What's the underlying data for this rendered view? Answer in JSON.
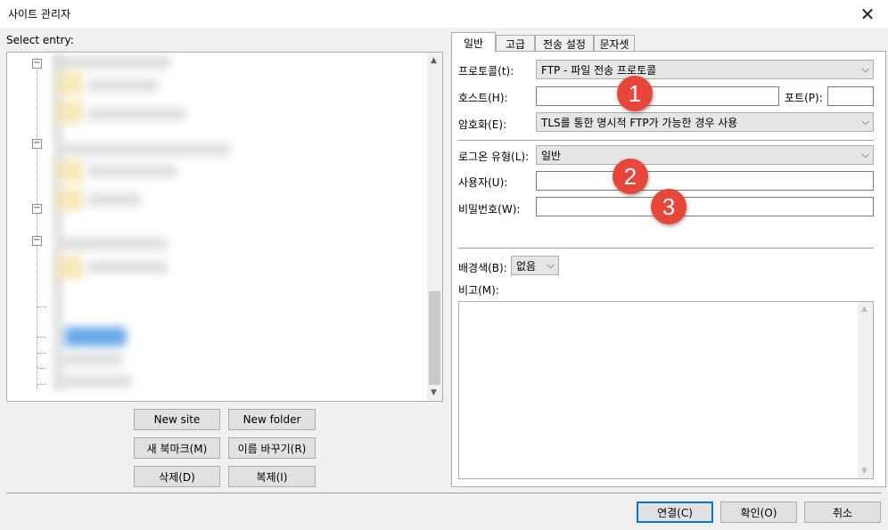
{
  "window": {
    "title": "사이트 관리자",
    "close_icon": "close-icon"
  },
  "left": {
    "select_entry_label": "Select entry:",
    "buttons": {
      "new_site": "New site",
      "new_folder": "New folder",
      "new_bookmark": "새 북마크(M)",
      "rename": "이름 바꾸기(R)",
      "delete": "삭제(D)",
      "duplicate": "복제(I)"
    }
  },
  "tabs": [
    "일반",
    "고급",
    "전송 설정",
    "문자셋"
  ],
  "general": {
    "protocol_label": "프로토콜(t):",
    "protocol_value": "FTP - 파일 전송 프로토콜",
    "host_label": "호스트(H):",
    "host_value": "",
    "port_label": "포트(P):",
    "port_value": "",
    "encryption_label": "암호화(E):",
    "encryption_value": "TLS를 통한 명시적 FTP가 가능한 경우 사용",
    "logon_type_label": "로그온 유형(L):",
    "logon_type_value": "일반",
    "user_label": "사용자(U):",
    "user_value": "",
    "password_label": "비밀번호(W):",
    "password_value": "",
    "bgcolor_label": "배경색(B):",
    "bgcolor_value": "없음",
    "comments_label": "비고(M):",
    "comments_value": ""
  },
  "annotations": [
    "1",
    "2",
    "3"
  ],
  "footer": {
    "connect": "연결(C)",
    "ok": "확인(O)",
    "cancel": "취소"
  },
  "colors": {
    "badge": "#e8463a",
    "default_button_border": "#0078d7"
  }
}
